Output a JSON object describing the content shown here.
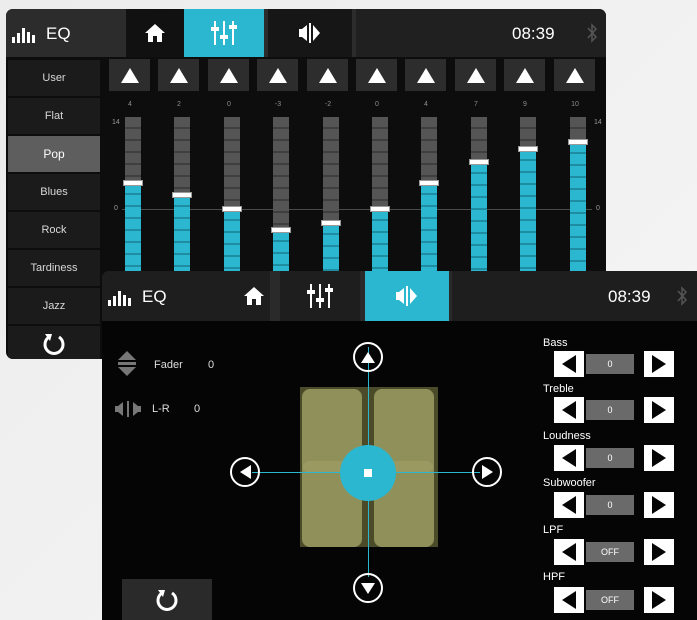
{
  "eq_screen": {
    "title": "EQ",
    "time": "08:39",
    "presets": [
      "User",
      "Flat",
      "Pop",
      "Blues",
      "Rock",
      "Tardiness",
      "Jazz"
    ],
    "selected_preset": "Pop",
    "scale_top": "14",
    "scale_mid": "0",
    "band_values": [
      "4",
      "2",
      "0",
      "-3",
      "-2",
      "0",
      "4",
      "7",
      "9",
      "10"
    ],
    "icons": [
      "equalizer-logo-icon",
      "home-icon",
      "eq-sliders-icon",
      "balance-icon",
      "bluetooth-icon",
      "reset-icon",
      "arrow-up-icon"
    ],
    "accent_color": "#2bb7cf"
  },
  "balance_screen": {
    "title": "EQ",
    "time": "08:39",
    "fader_label": "Fader",
    "fader_value": "0",
    "lr_label": "L-R",
    "lr_value": "0",
    "controls": [
      {
        "label": "Bass",
        "value": "0"
      },
      {
        "label": "Treble",
        "value": "0"
      },
      {
        "label": "Loudness",
        "value": "0"
      },
      {
        "label": "Subwoofer",
        "value": "0"
      },
      {
        "label": "LPF",
        "value": "OFF"
      },
      {
        "label": "HPF",
        "value": "OFF"
      }
    ],
    "icons": [
      "equalizer-logo-icon",
      "home-icon",
      "eq-sliders-icon",
      "balance-icon",
      "bluetooth-icon",
      "fader-icon",
      "speaker-lr-icon",
      "arrow-up-icon",
      "arrow-down-icon",
      "arrow-left-icon",
      "arrow-right-icon",
      "reset-icon"
    ]
  }
}
